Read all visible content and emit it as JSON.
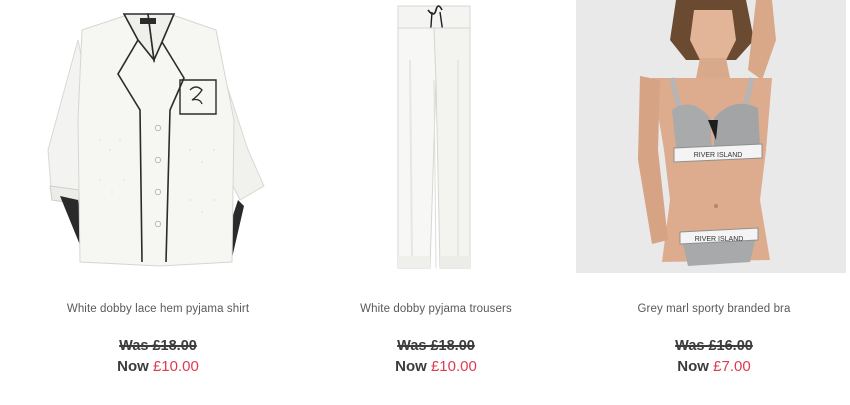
{
  "products": [
    {
      "title": "White dobby lace hem pyjama shirt",
      "was_price": "Was £18.00",
      "now_label": "Now",
      "now_price": "£10.00",
      "image": "white-pyjama-shirt"
    },
    {
      "title": "White dobby pyjama trousers",
      "was_price": "Was £18.00",
      "now_label": "Now",
      "now_price": "£10.00",
      "image": "white-pyjama-trousers"
    },
    {
      "title": "Grey marl sporty branded bra",
      "was_price": "Was £16.00",
      "now_label": "Now",
      "now_price": "£7.00",
      "image": "model-grey-sporty-bra",
      "image_text": "RIVER ISLAND"
    }
  ],
  "colors": {
    "sale_price": "#dd3c4f",
    "text": "#3c3c3c",
    "title": "#595959",
    "image_bg": "#ebebeb"
  }
}
